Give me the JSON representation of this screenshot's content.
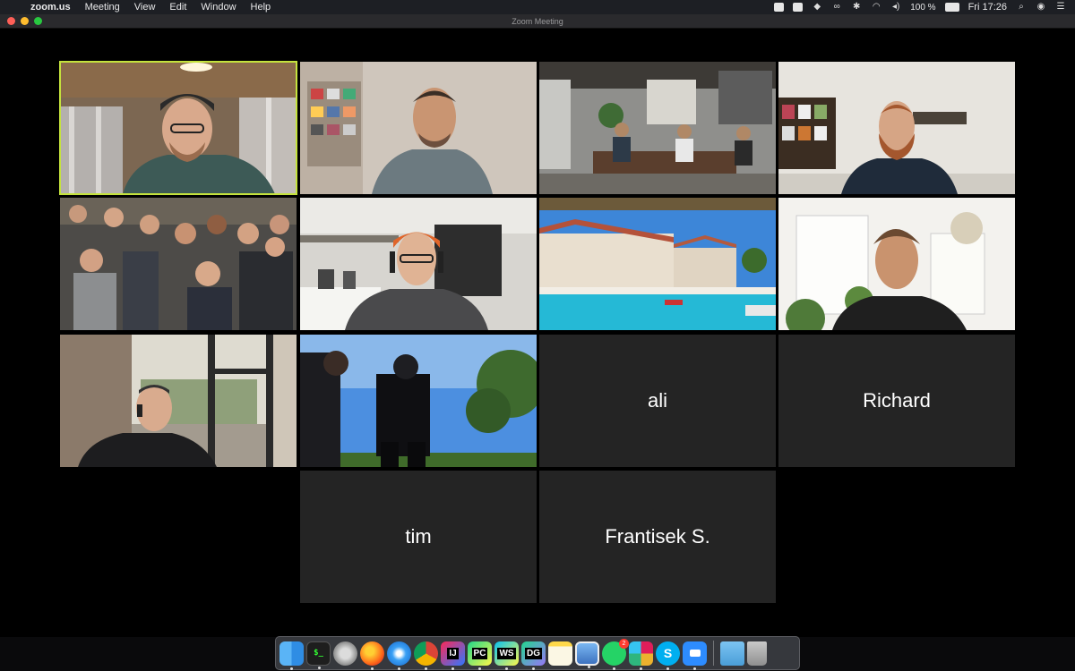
{
  "menubar": {
    "app_name": "zoom.us",
    "menus": [
      "Meeting",
      "View",
      "Edit",
      "Window",
      "Help"
    ],
    "battery": "100 %",
    "clock": "Fri 17:26"
  },
  "window": {
    "title": "Zoom Meeting"
  },
  "participants": {
    "ali": "ali",
    "richard": "Richard",
    "tim": "tim",
    "frantisek": "Frantisek S."
  },
  "colors": {
    "active_speaker_border": "#c5e33d",
    "name_tile_bg": "#242424"
  },
  "dock": {
    "apps": [
      "finder-icon",
      "terminal-icon",
      "launchpad-icon",
      "firefox-icon",
      "safari-icon",
      "chrome-icon",
      "intellij-icon",
      "pycharm-icon",
      "webstorm-icon",
      "datagrip-icon",
      "notes-icon",
      "preview-icon",
      "whatsapp-icon",
      "slack-icon",
      "skype-icon",
      "zoom-icon",
      "downloads-folder-icon",
      "trash-icon"
    ],
    "labels": {
      "terminal": "$_",
      "intellij": "IJ",
      "pycharm": "PC",
      "webstorm": "WS",
      "datagrip": "DG",
      "skype": "S"
    },
    "whatsapp_badge": "2"
  }
}
